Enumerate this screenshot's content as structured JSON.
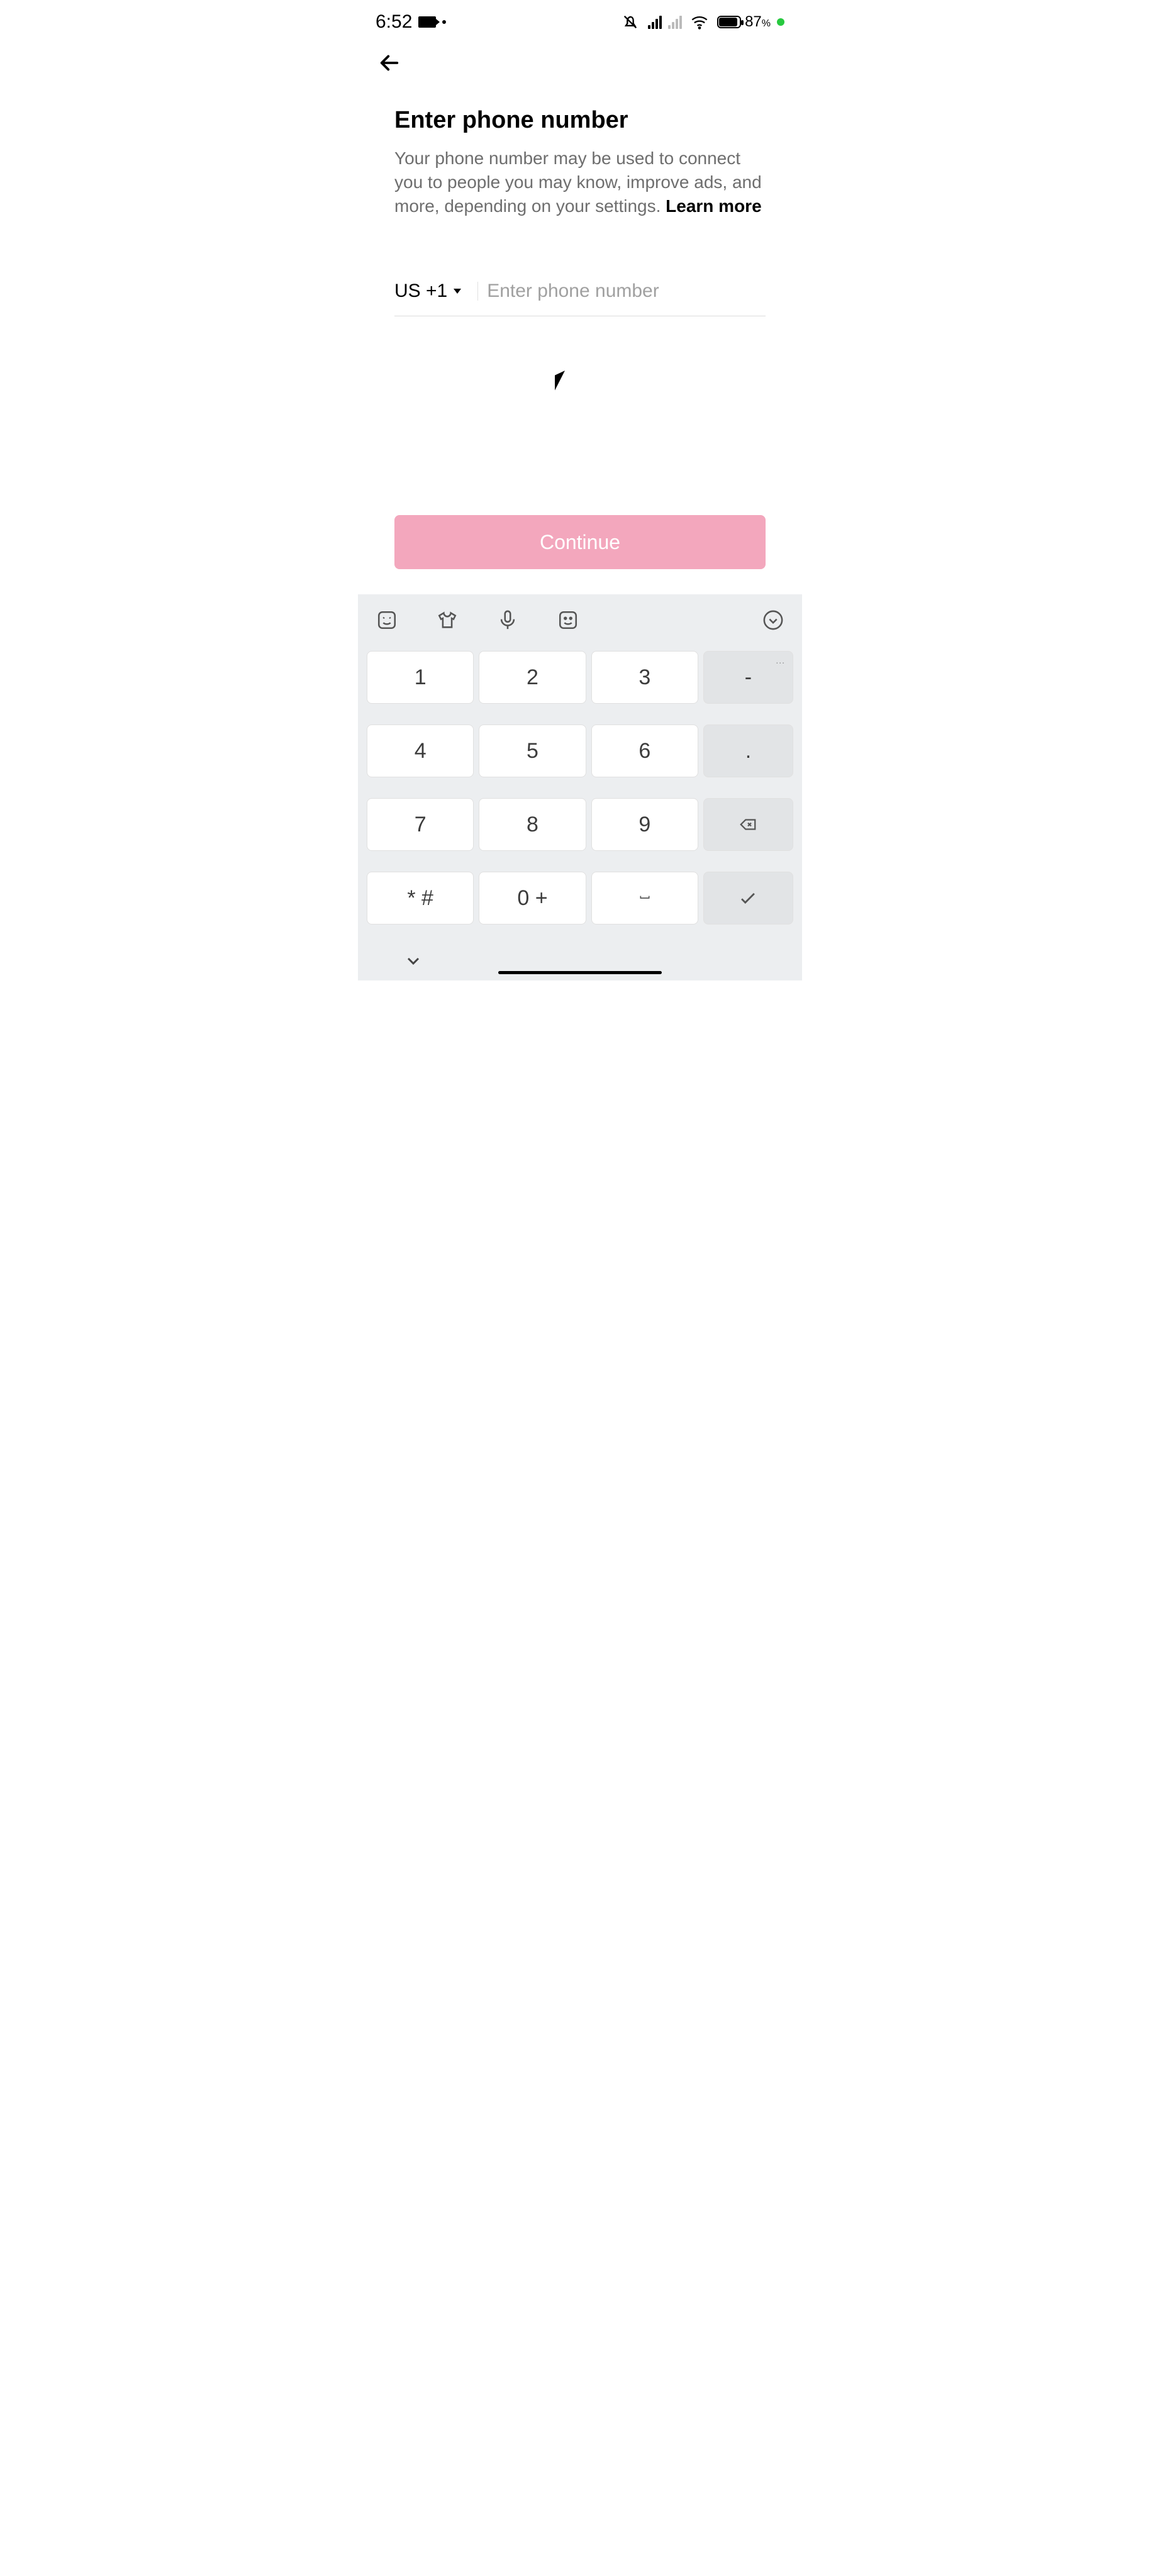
{
  "status": {
    "time": "6:52",
    "battery_pct": "87",
    "pct_suffix": "%"
  },
  "page": {
    "title": "Enter phone number",
    "subtitle_prefix": "Your phone number may be used to connect you to people you may know, improve ads, and more, depending on your settings. ",
    "learn_more": "Learn more"
  },
  "phone": {
    "country_code": "US +1",
    "placeholder": "Enter phone number",
    "value": ""
  },
  "actions": {
    "continue": "Continue"
  },
  "keyboard": {
    "keys": {
      "k1": "1",
      "k2": "2",
      "k3": "3",
      "dash": "-",
      "k4": "4",
      "k5": "5",
      "k6": "6",
      "dot": ".",
      "k7": "7",
      "k8": "8",
      "k9": "9",
      "sym": "* #",
      "k0": "0 +",
      "dots_more": "..."
    }
  }
}
